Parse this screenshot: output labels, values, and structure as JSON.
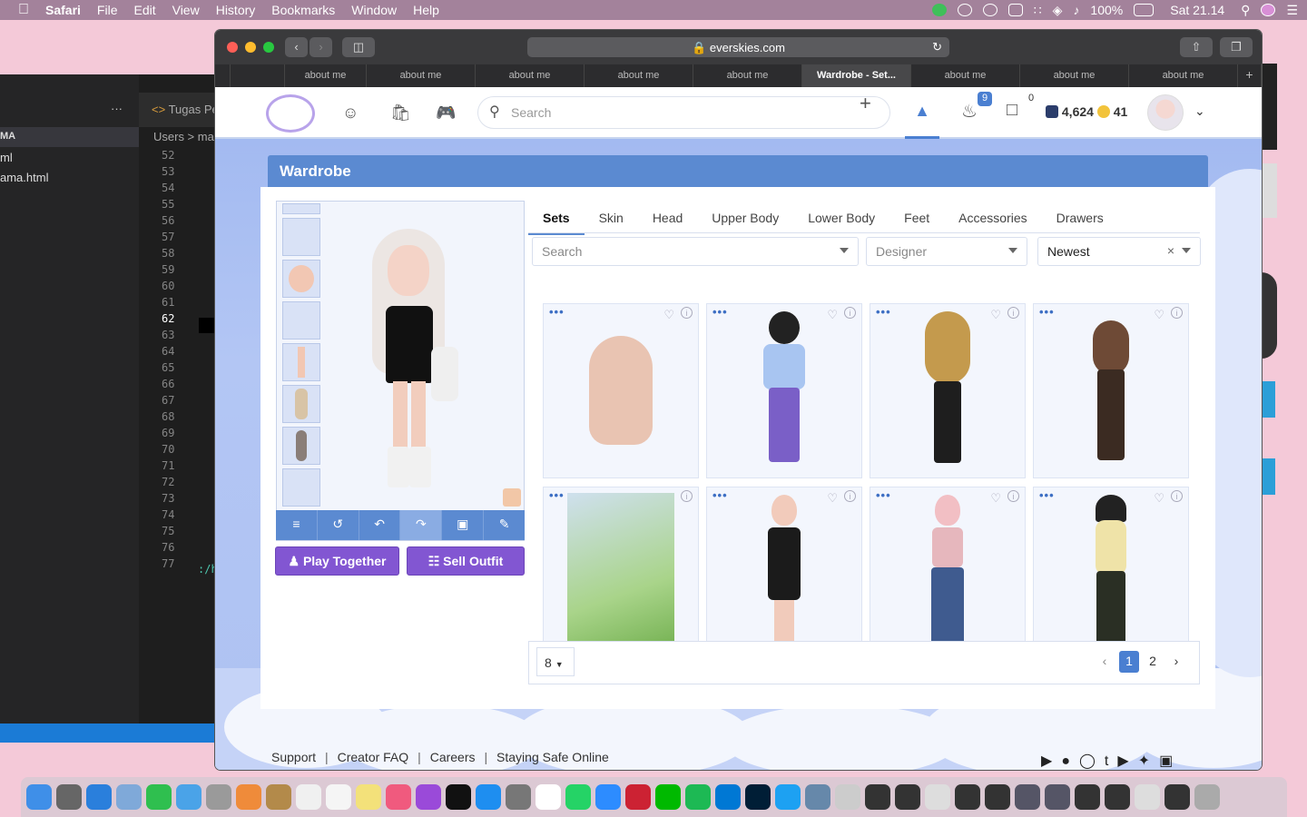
{
  "menubar": {
    "app": "Safari",
    "items": [
      "File",
      "Edit",
      "View",
      "History",
      "Bookmarks",
      "Window",
      "Help"
    ],
    "battery": "100%",
    "clock": "Sat 21.14"
  },
  "editor": {
    "dots": "···",
    "section": "MA",
    "files": [
      "ml",
      "ama.html"
    ],
    "tab": "Tugas Pe",
    "crumb": "Users > ma",
    "lines": [
      "52",
      "53",
      "54",
      "55",
      "56",
      "57",
      "58",
      "59",
      "60",
      "61",
      "62",
      "63",
      "64",
      "65",
      "66",
      "67",
      "68",
      "69",
      "70",
      "71",
      "72",
      "73",
      "74",
      "75",
      "76",
      "77"
    ],
    "current_line": "62",
    "line77_text": ":/h"
  },
  "browser": {
    "url": "everskies.com",
    "tabs": [
      "about me",
      "about me",
      "about me",
      "about me",
      "about me",
      "Wardrobe - Set...",
      "about me",
      "about me",
      "about me"
    ],
    "active_tab": 5,
    "new_tab": "+"
  },
  "nav": {
    "search_placeholder": "Search",
    "plus": "+",
    "notif_count": "9",
    "chat_count": "0",
    "gems": "4,624",
    "coins": "41"
  },
  "wardrobe": {
    "title": "Wardrobe",
    "tabs": [
      "Sets",
      "Skin",
      "Head",
      "Upper Body",
      "Lower Body",
      "Feet",
      "Accessories",
      "Drawers"
    ],
    "active_tab": "Sets",
    "search_placeholder": "Search",
    "designer_placeholder": "Designer",
    "sort": "Newest",
    "sort_clear": "×",
    "cards": [
      "set-1",
      "set-2",
      "set-3",
      "set-4",
      "set-5",
      "set-6",
      "set-7",
      "set-8"
    ],
    "more": "•••",
    "per_page": "8",
    "pages": [
      "1",
      "2"
    ],
    "current_page": "1",
    "prev": "‹",
    "next": "›"
  },
  "buttons": {
    "play_together": "Play Together",
    "sell_outfit": "Sell Outfit"
  },
  "tools": [
    "clear",
    "undo-all",
    "undo",
    "redo",
    "save",
    "edit"
  ],
  "footer": {
    "links": [
      "Support",
      "Creator FAQ",
      "Careers",
      "Staying Safe Online"
    ]
  },
  "colors": {
    "accent": "#5b8ad1",
    "purple": "#8256d2"
  }
}
